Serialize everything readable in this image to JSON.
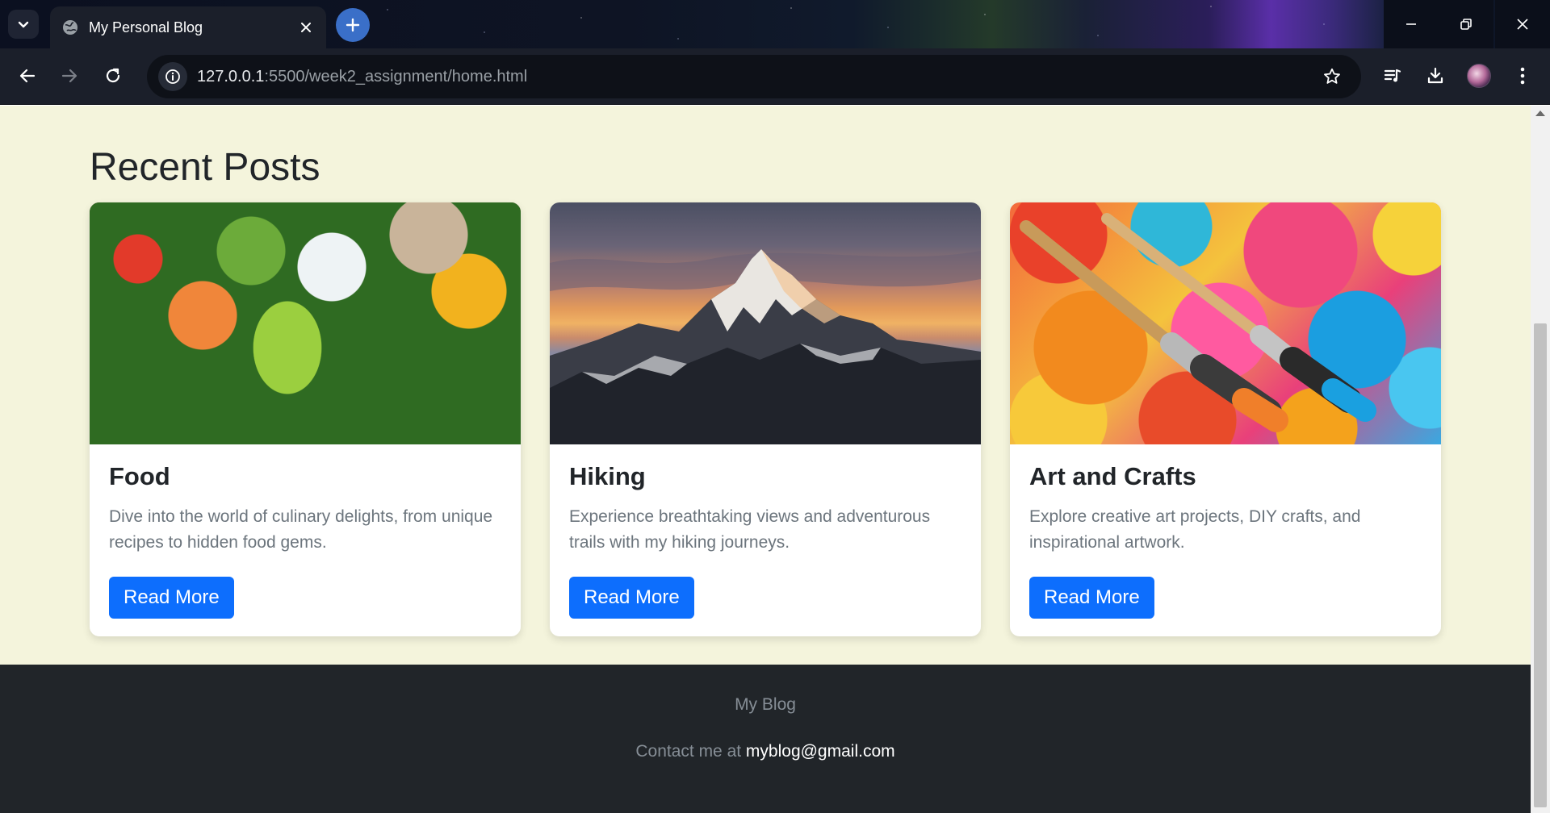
{
  "browser": {
    "tab": {
      "title": "My Personal Blog"
    },
    "url": {
      "host": "127.0.0.1",
      "rest": ":5500/week2_assignment/home.html"
    }
  },
  "page": {
    "section_title": "Recent Posts",
    "posts": [
      {
        "title": "Food",
        "text": "Dive into the world of culinary delights, from unique recipes to hidden food gems.",
        "button": "Read More"
      },
      {
        "title": "Hiking",
        "text": "Experience breathtaking views and adventurous trails with my hiking journeys.",
        "button": "Read More"
      },
      {
        "title": "Art and Crafts",
        "text": "Explore creative art projects, DIY crafts, and inspirational artwork.",
        "button": "Read More"
      }
    ],
    "footer": {
      "brand": "My Blog",
      "contact_prefix": "Contact me at ",
      "email": "myblog@gmail.com"
    }
  },
  "colors": {
    "page_bg": "#f4f4dc",
    "button_bg": "#0d6efd",
    "footer_bg": "#212529"
  },
  "icons": {
    "tab_list": "chevron-down-icon",
    "favicon": "globe-icon",
    "new_tab": "plus-icon",
    "back": "arrow-left-icon",
    "forward": "arrow-right-icon",
    "reload": "reload-icon",
    "site_info": "info-icon",
    "bookmark": "star-icon",
    "media": "media-queue-icon",
    "downloads": "download-icon",
    "profile": "avatar",
    "menu": "kebab-menu-icon"
  }
}
